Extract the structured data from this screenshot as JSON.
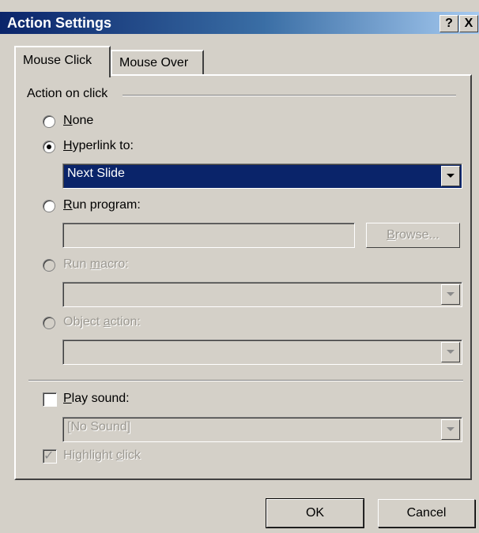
{
  "window": {
    "title": "Action Settings",
    "help_glyph": "?",
    "close_glyph": "X"
  },
  "tabs": [
    {
      "label": "Mouse Click",
      "active": true
    },
    {
      "label": "Mouse Over",
      "active": false
    }
  ],
  "action_group": {
    "label": "Action on click"
  },
  "options": {
    "none": {
      "mnemonic": "N",
      "rest": "one",
      "selected": false,
      "enabled": true
    },
    "hyperlink": {
      "mnemonic": "H",
      "rest": "yperlink to:",
      "selected": true,
      "enabled": true,
      "value": "Next Slide"
    },
    "run_program": {
      "mnemonic": "R",
      "rest": "un program:",
      "selected": false,
      "enabled": true,
      "value": "",
      "browse_prefix": "",
      "browse_mnemonic": "B",
      "browse_rest": "rowse..."
    },
    "run_macro": {
      "prefix": "Run ",
      "mnemonic": "m",
      "rest": "acro:",
      "selected": false,
      "enabled": false,
      "value": ""
    },
    "object_action": {
      "prefix": "Object ",
      "mnemonic": "a",
      "rest": "ction:",
      "selected": false,
      "enabled": false,
      "value": ""
    }
  },
  "play_sound": {
    "mnemonic": "P",
    "rest": "lay sound:",
    "checked": false,
    "value": "[No Sound]"
  },
  "highlight_click": {
    "prefix": "Highlight ",
    "mnemonic": "c",
    "rest": "lick",
    "checked": true,
    "enabled": false
  },
  "buttons": {
    "ok": "OK",
    "cancel": "Cancel"
  },
  "colors": {
    "face": "#d4d0c8",
    "selection": "#0a246a",
    "title_start": "#0a246a",
    "title_end": "#a6caf0"
  }
}
